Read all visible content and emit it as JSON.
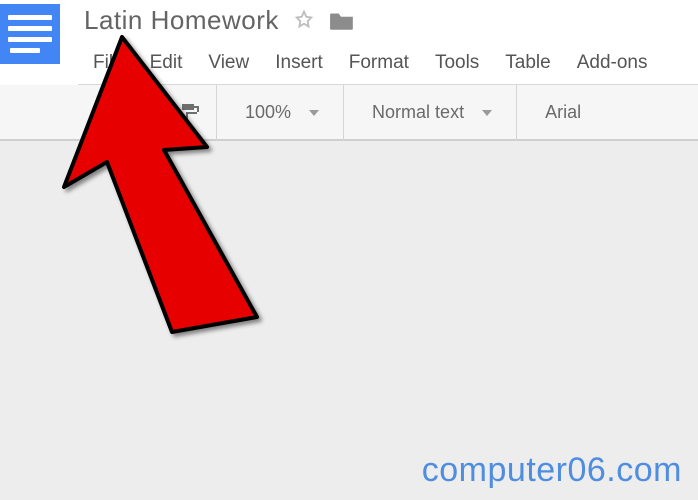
{
  "document": {
    "title": "Latin Homework"
  },
  "menus": {
    "file": "File",
    "edit": "Edit",
    "view": "View",
    "insert": "Insert",
    "format": "Format",
    "tools": "Tools",
    "table": "Table",
    "addons": "Add-ons"
  },
  "toolbar": {
    "zoom": "100%",
    "paragraph_style": "Normal text",
    "font": "Arial"
  },
  "watermark": "computer06.com"
}
